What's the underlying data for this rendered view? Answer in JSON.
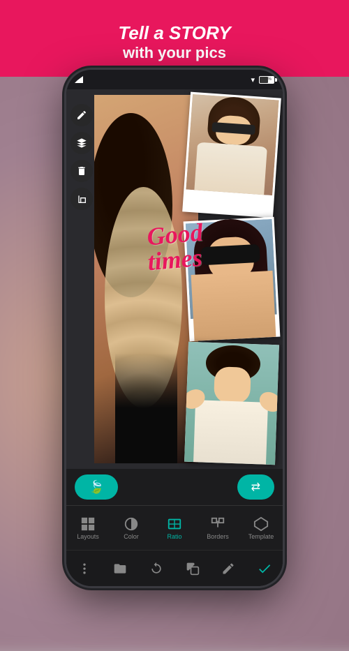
{
  "banner": {
    "line1": "Tell a STORY",
    "line2": "with your pics"
  },
  "status_bar": {
    "battery_percent": "59%"
  },
  "toolbar_left": {
    "buttons": [
      {
        "id": "edit",
        "icon": "✏️"
      },
      {
        "id": "layers",
        "icon": "▲"
      },
      {
        "id": "delete",
        "icon": "🗑"
      },
      {
        "id": "crop",
        "icon": "⊡"
      }
    ]
  },
  "teal_bar": {
    "left_btn": "🍃",
    "right_btn": "⇄"
  },
  "bottom_tools": {
    "items": [
      {
        "id": "layouts",
        "label": "Layouts",
        "active": false
      },
      {
        "id": "color",
        "label": "Color",
        "active": false
      },
      {
        "id": "ratio",
        "label": "Ratio",
        "active": true
      },
      {
        "id": "borders",
        "label": "Borders",
        "active": false
      },
      {
        "id": "template",
        "label": "Template",
        "active": false
      }
    ]
  },
  "action_bar": {
    "buttons": [
      {
        "id": "menu",
        "icon": "⋮"
      },
      {
        "id": "folder",
        "icon": "📁"
      },
      {
        "id": "rotate",
        "icon": "↻"
      },
      {
        "id": "copy",
        "icon": "❐"
      },
      {
        "id": "pencil",
        "icon": "✏"
      },
      {
        "id": "check",
        "icon": "✓"
      }
    ]
  },
  "collage": {
    "text_overlay": {
      "line1": "Good",
      "line2": "times"
    }
  }
}
